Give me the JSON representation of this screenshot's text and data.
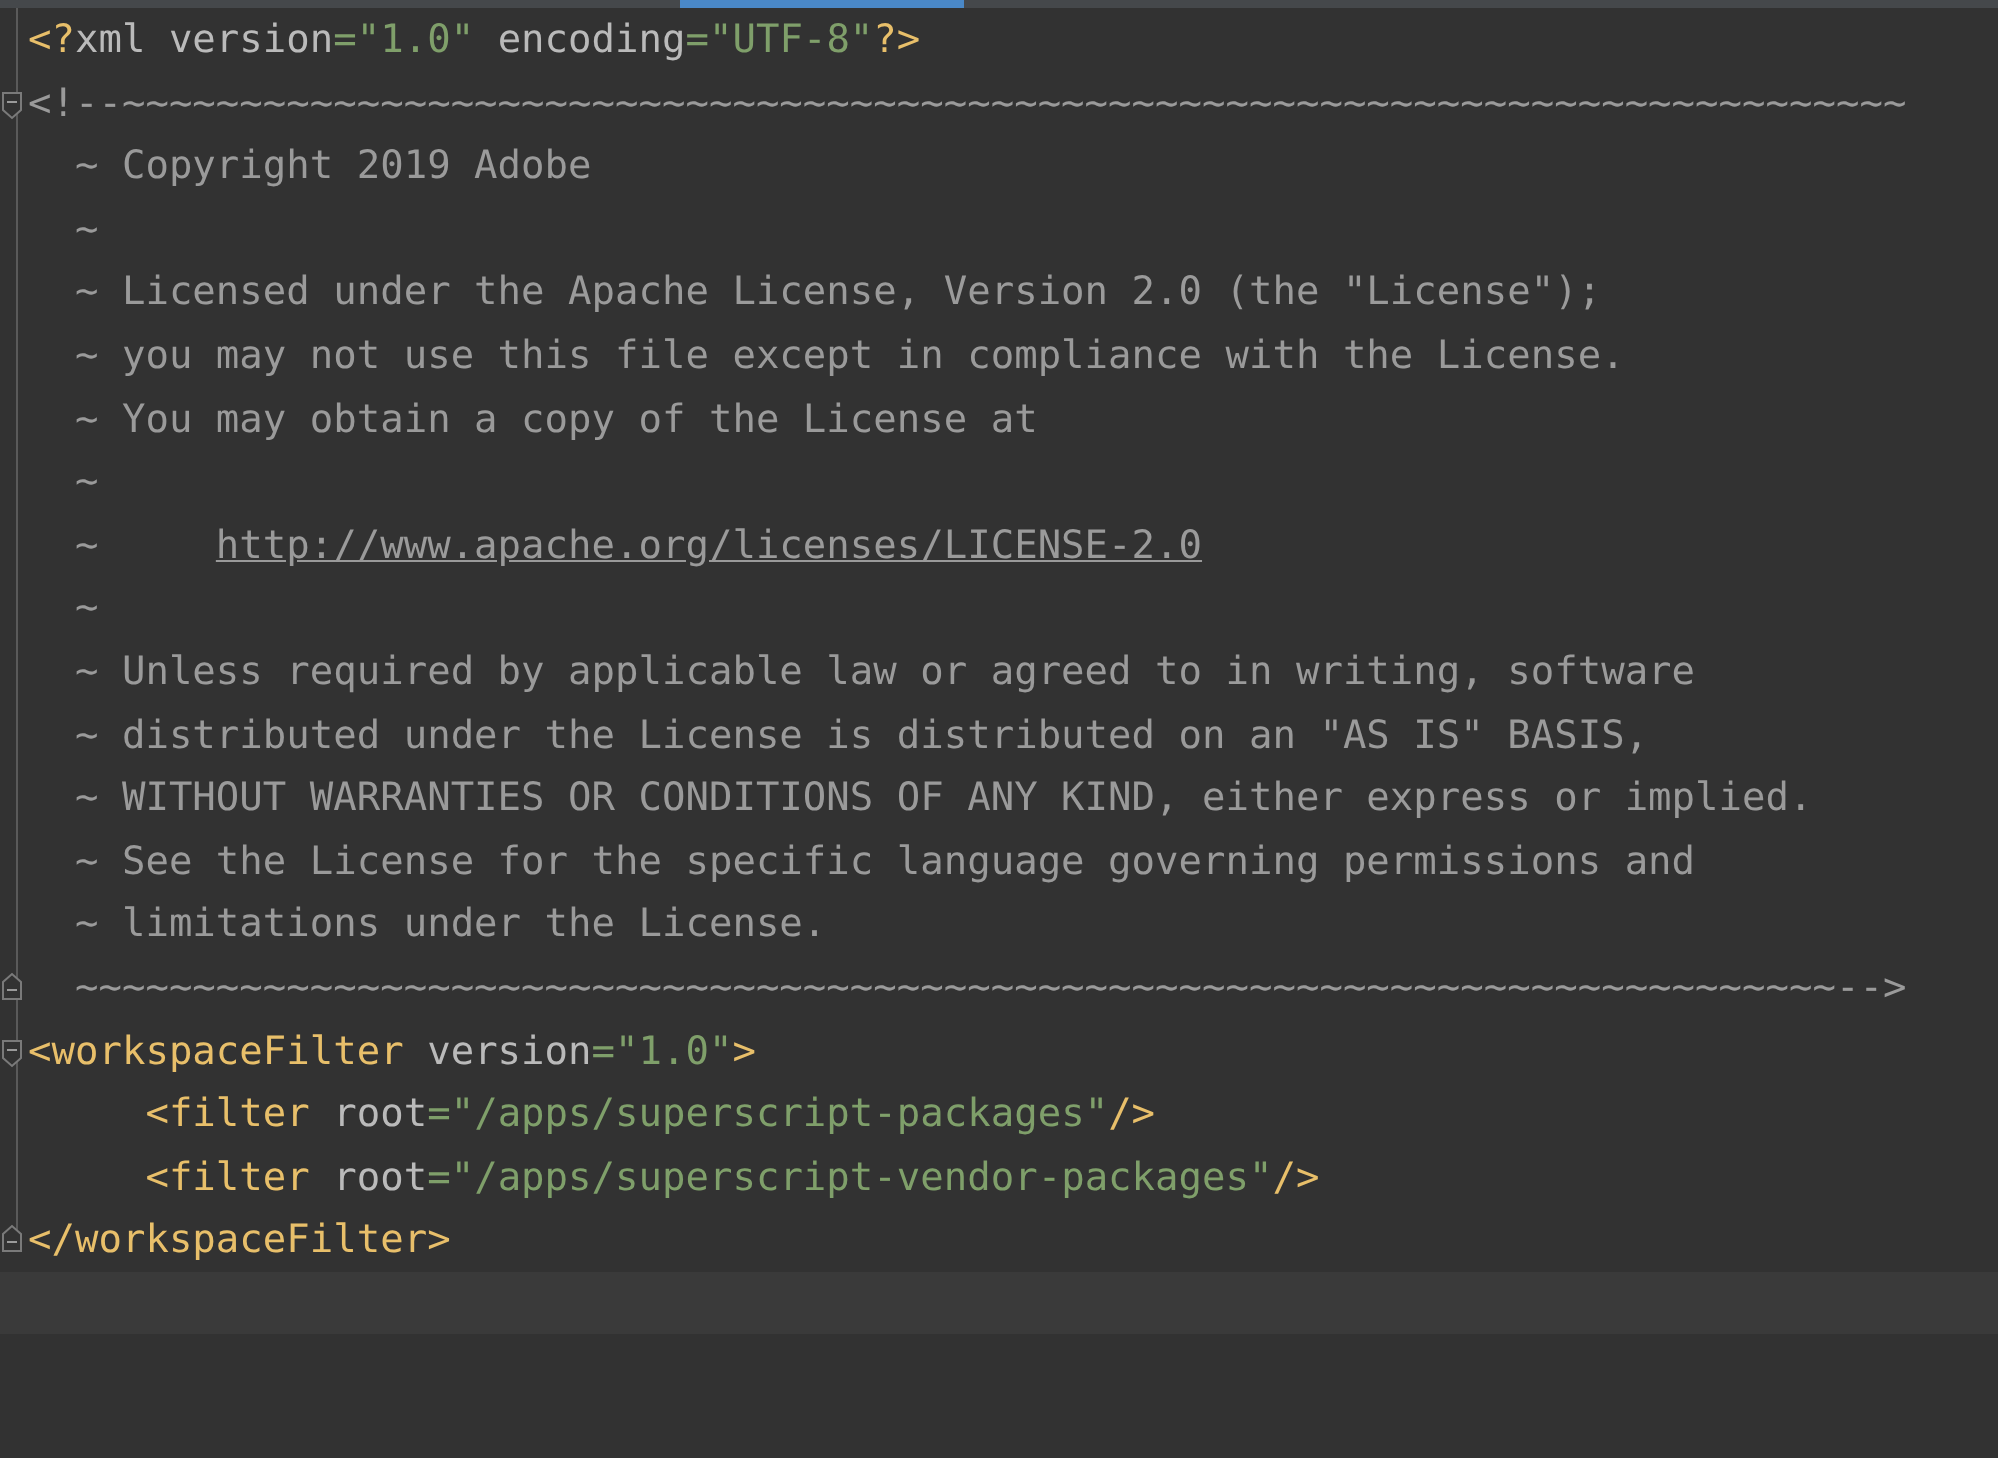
{
  "editor": {
    "lines": [
      {
        "tokens": [
          {
            "kind": "tag",
            "text": "<?"
          },
          {
            "kind": "attr",
            "text": "xml version"
          },
          {
            "kind": "value",
            "text": "=\"1.0\""
          },
          {
            "kind": "attr",
            "text": " encoding"
          },
          {
            "kind": "value",
            "text": "=\"UTF-8\""
          },
          {
            "kind": "tag",
            "text": "?>"
          }
        ]
      },
      {
        "fold_start": true,
        "tokens": [
          {
            "kind": "comment",
            "text": "<!--~~~~~~~~~~~~~~~~~~~~~~~~~~~~~~~~~~~~~~~~~~~~~~~~~~~~~~~~~~~~~~~~~~~~~~~~~~~~"
          }
        ]
      },
      {
        "tokens": [
          {
            "kind": "comment",
            "text": "  ~ Copyright 2019 Adobe"
          }
        ]
      },
      {
        "tokens": [
          {
            "kind": "comment",
            "text": "  ~"
          }
        ]
      },
      {
        "tokens": [
          {
            "kind": "comment",
            "text": "  ~ Licensed under the Apache License, Version 2.0 (the \"License\");"
          }
        ]
      },
      {
        "tokens": [
          {
            "kind": "comment",
            "text": "  ~ you may not use this file except in compliance with the License."
          }
        ]
      },
      {
        "tokens": [
          {
            "kind": "comment",
            "text": "  ~ You may obtain a copy of the License at"
          }
        ]
      },
      {
        "tokens": [
          {
            "kind": "comment",
            "text": "  ~"
          }
        ]
      },
      {
        "tokens": [
          {
            "kind": "comment",
            "text": "  ~     "
          },
          {
            "kind": "link",
            "text": "http://www.apache.org/licenses/LICENSE-2.0"
          }
        ]
      },
      {
        "tokens": [
          {
            "kind": "comment",
            "text": "  ~"
          }
        ]
      },
      {
        "tokens": [
          {
            "kind": "comment",
            "text": "  ~ Unless required by applicable law or agreed to in writing, software"
          }
        ]
      },
      {
        "tokens": [
          {
            "kind": "comment",
            "text": "  ~ distributed under the License is distributed on an \"AS IS\" BASIS,"
          }
        ]
      },
      {
        "tokens": [
          {
            "kind": "comment",
            "text": "  ~ WITHOUT WARRANTIES OR CONDITIONS OF ANY KIND, either express or implied."
          }
        ]
      },
      {
        "tokens": [
          {
            "kind": "comment",
            "text": "  ~ See the License for the specific language governing permissions and"
          }
        ]
      },
      {
        "tokens": [
          {
            "kind": "comment",
            "text": "  ~ limitations under the License."
          }
        ]
      },
      {
        "fold_end": true,
        "tokens": [
          {
            "kind": "comment",
            "text": "  ~~~~~~~~~~~~~~~~~~~~~~~~~~~~~~~~~~~~~~~~~~~~~~~~~~~~~~~~~~~~~~~~~~~~~~~~~~~-->"
          }
        ]
      },
      {
        "fold_start": true,
        "tokens": [
          {
            "kind": "tag",
            "text": "<workspaceFilter"
          },
          {
            "kind": "attr",
            "text": " version"
          },
          {
            "kind": "value",
            "text": "=\"1.0\""
          },
          {
            "kind": "tag",
            "text": ">"
          }
        ]
      },
      {
        "tokens": [
          {
            "kind": "tag",
            "text": "     <filter"
          },
          {
            "kind": "attr",
            "text": " root"
          },
          {
            "kind": "value",
            "text": "=\"/apps/superscript-packages\""
          },
          {
            "kind": "tag",
            "text": "/>"
          }
        ]
      },
      {
        "tokens": [
          {
            "kind": "tag",
            "text": "     <filter"
          },
          {
            "kind": "attr",
            "text": " root"
          },
          {
            "kind": "value",
            "text": "=\"/apps/superscript-vendor-packages\""
          },
          {
            "kind": "tag",
            "text": "/>"
          }
        ]
      },
      {
        "fold_end": true,
        "tokens": [
          {
            "kind": "tag",
            "text": "</workspaceFilter>"
          }
        ]
      },
      {
        "current": true
      }
    ]
  }
}
